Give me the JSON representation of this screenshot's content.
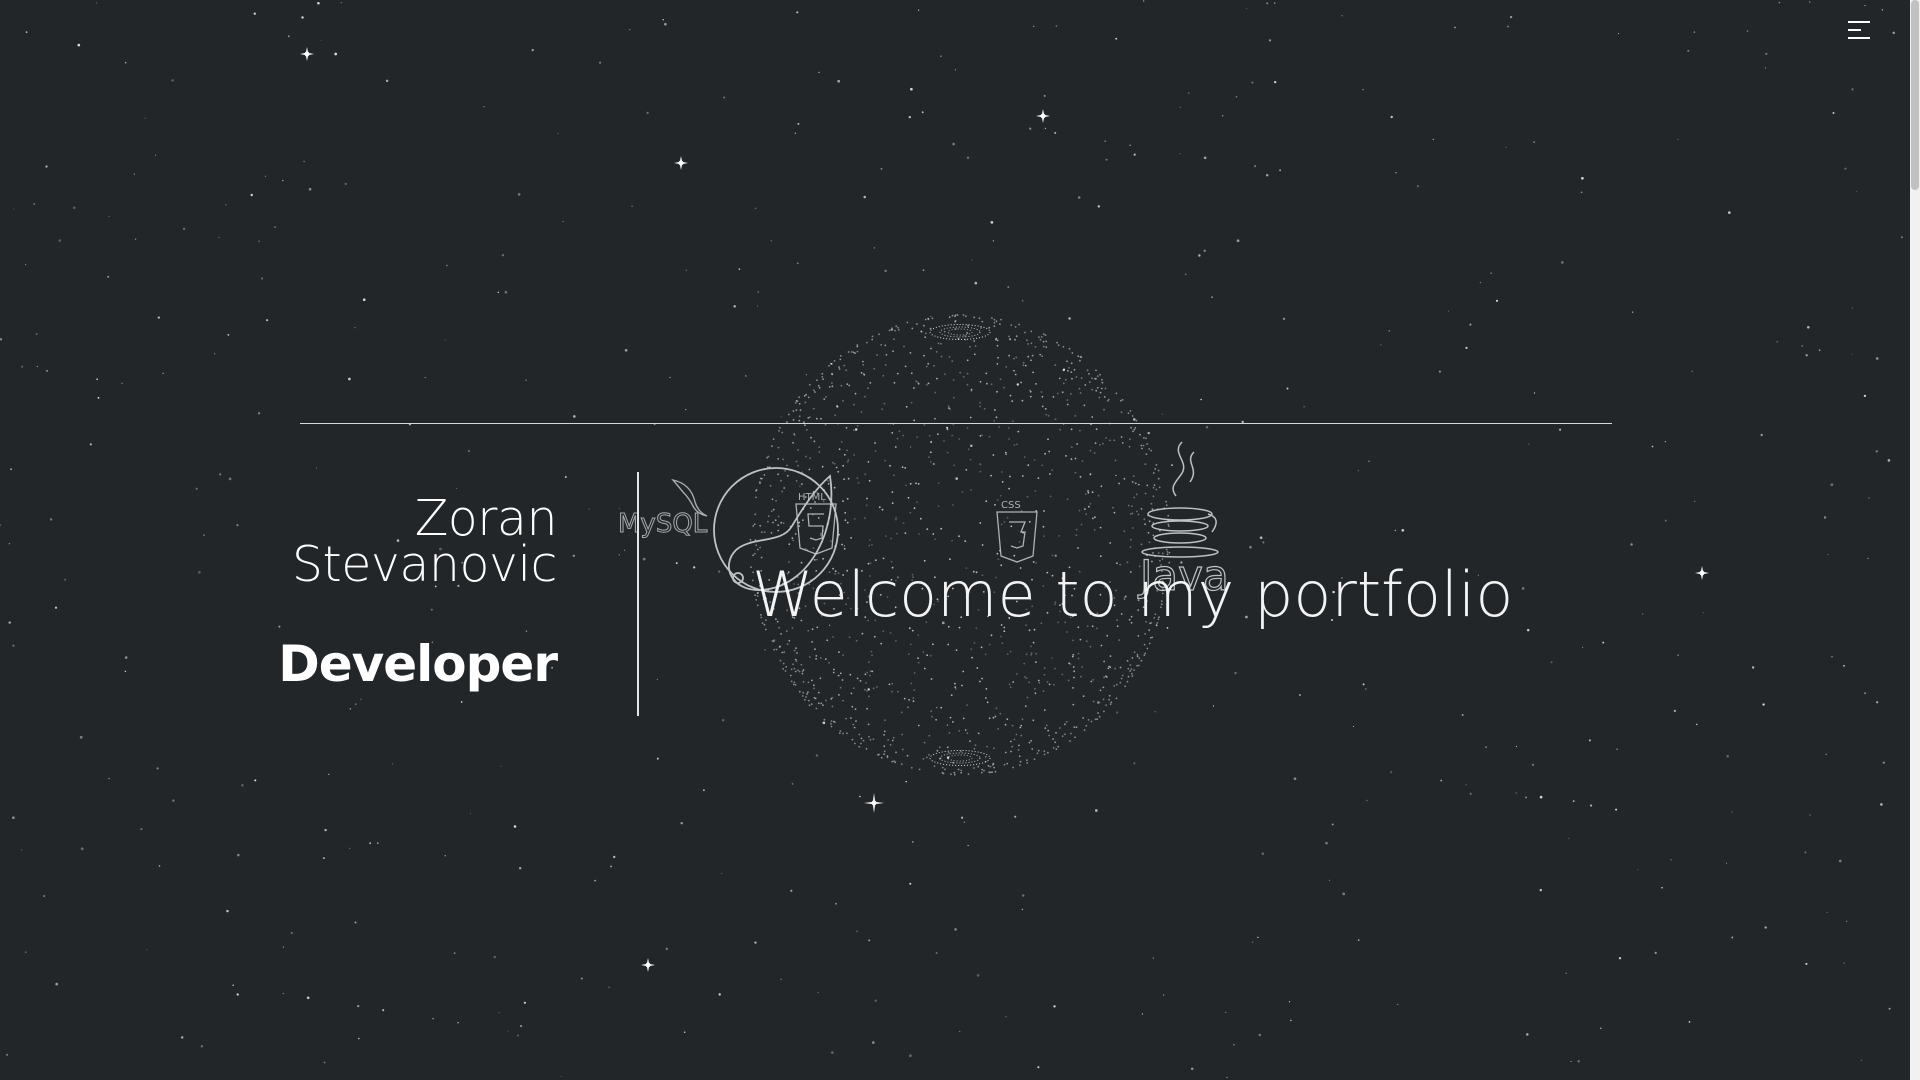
{
  "hero": {
    "name_first": "Zoran",
    "name_last": "Stevanovic",
    "role": "Developer",
    "welcome": "Welcome to my portfolio"
  },
  "menu": {
    "icon": "hamburger-menu-icon"
  },
  "globe": {
    "tech_logos": [
      {
        "name": "mysql-logo",
        "label": "MySQL"
      },
      {
        "name": "html5-logo",
        "label": "HTML"
      },
      {
        "name": "css3-logo",
        "label": "CSS"
      },
      {
        "name": "java-logo",
        "label": "Java"
      }
    ]
  },
  "colors": {
    "background": "#222629",
    "text": "#ffffff",
    "line": "#d8d8d8"
  }
}
